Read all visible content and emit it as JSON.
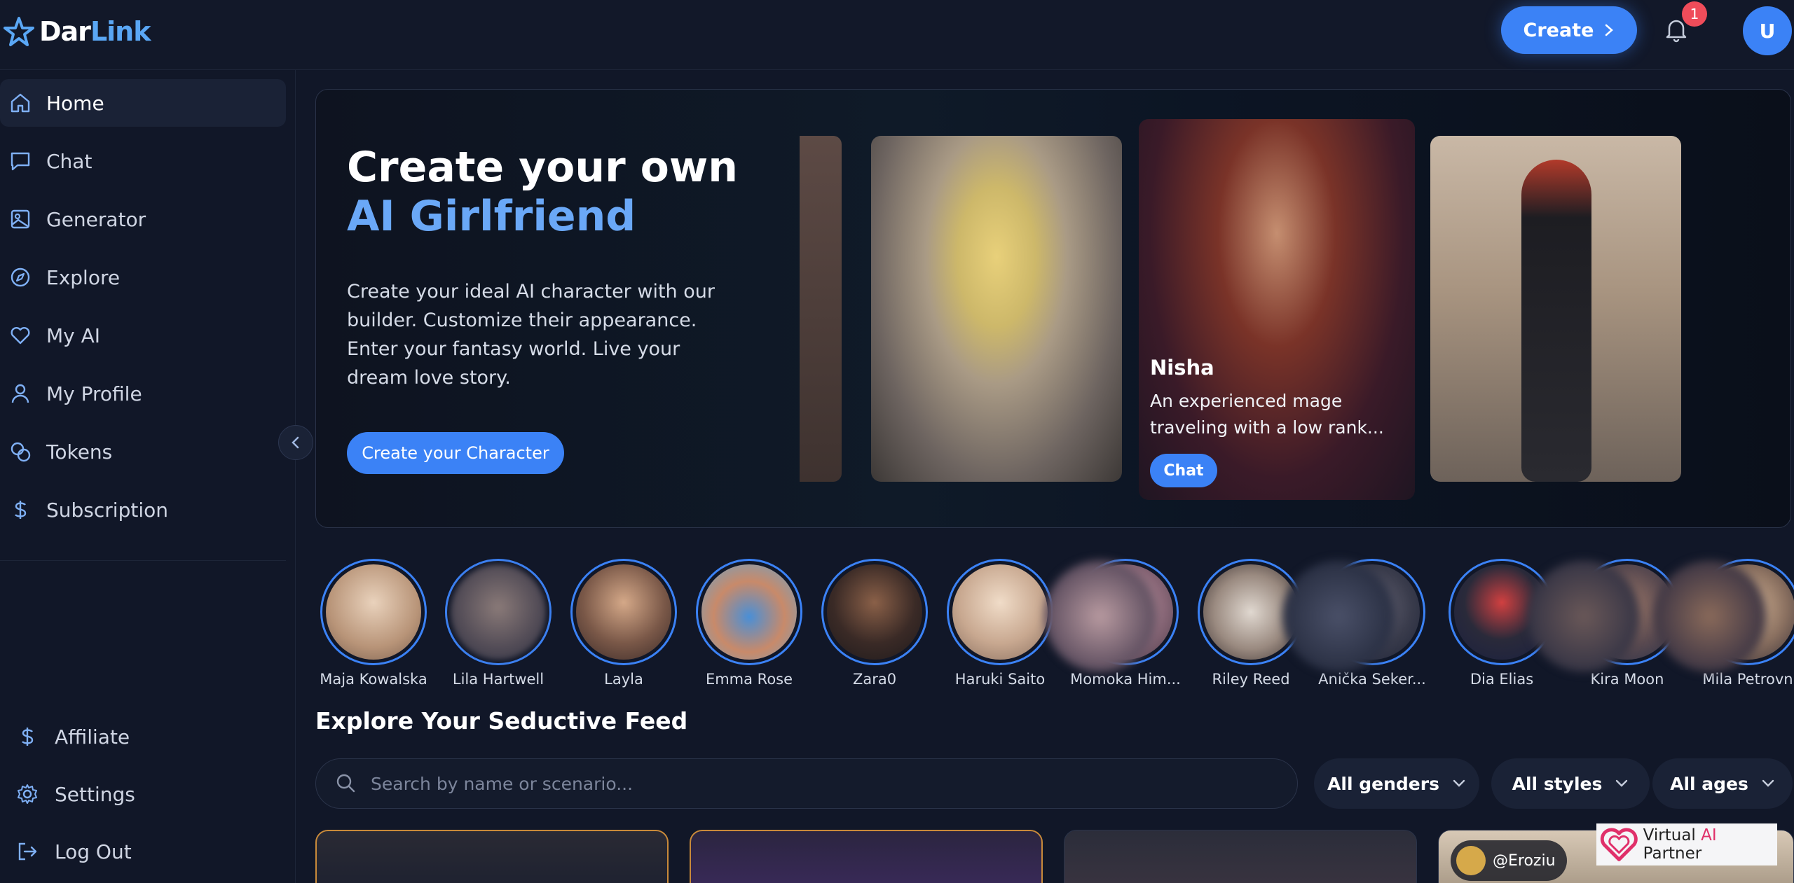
{
  "app": {
    "logo_part1": "Dar",
    "logo_part2": "Link"
  },
  "header": {
    "create_label": "Create",
    "notification_count": "1",
    "avatar_initial": "U"
  },
  "sidebar": {
    "items": [
      {
        "label": "Home",
        "icon": "home-icon",
        "active": true
      },
      {
        "label": "Chat",
        "icon": "chat-icon"
      },
      {
        "label": "Generator",
        "icon": "image-icon"
      },
      {
        "label": "Explore",
        "icon": "compass-icon"
      },
      {
        "label": "My AI",
        "icon": "heart-icon"
      },
      {
        "label": "My Profile",
        "icon": "user-icon"
      },
      {
        "label": "Tokens",
        "icon": "coins-icon"
      },
      {
        "label": "Subscription",
        "icon": "dollar-icon"
      }
    ],
    "bottom": [
      {
        "label": "Affiliate",
        "icon": "dollar-icon"
      },
      {
        "label": "Settings",
        "icon": "gear-icon"
      },
      {
        "label": "Log Out",
        "icon": "logout-icon"
      }
    ]
  },
  "hero": {
    "title_line1": "Create your own",
    "title_line2": "AI Girlfriend",
    "description": "Create your ideal AI character with our builder. Customize their appearance. Enter your fantasy world. Live your dream love story.",
    "cta_label": "Create your Character",
    "featured": {
      "name": "Nisha",
      "description": "An experienced mage traveling with a low rank...",
      "chat_label": "Chat"
    }
  },
  "stories": [
    "Maja Kowalska",
    "Lila Hartwell",
    "Layla",
    "Emma Rose",
    "Zara0",
    "Haruki Saito",
    "Momoka Him...",
    "Riley Reed",
    "Anička Seker...",
    "Dia Elias",
    "Kira Moon",
    "Mila Petrovn"
  ],
  "feed": {
    "title": "Explore Your Seductive Feed",
    "search_placeholder": "Search by name or scenario...",
    "filters": {
      "gender": "All genders",
      "style": "All styles",
      "age": "All ages"
    },
    "creator_handle": "@Eroziu"
  },
  "partner_badge": {
    "text_part1": "Virtual ",
    "text_ai": "AI",
    "text_part2": " Partner"
  },
  "colors": {
    "accent": "#3b82f6",
    "accent_light": "#6aa8f7",
    "background": "#111728",
    "badge": "#ef4c5a"
  }
}
